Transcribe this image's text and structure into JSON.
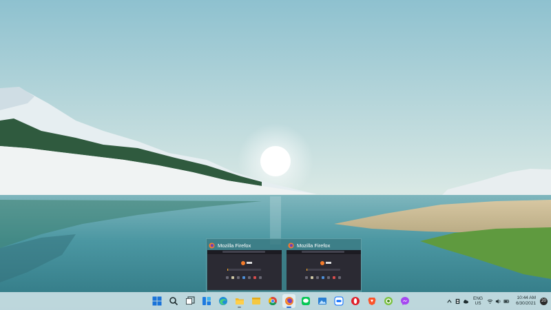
{
  "wallpaper": {
    "sky_top": "#8ec1cf",
    "sky_bottom": "#c7dfde",
    "water": "#4d96a1",
    "sun": "#ffffff"
  },
  "thumbnails": {
    "items": [
      {
        "title": "Mozilla Firefox"
      },
      {
        "title": "Mozilla Firefox"
      }
    ]
  },
  "taskbar": {
    "accent": "#2a6ad4",
    "apps": [
      {
        "name": "start-button",
        "icon": "windows-logo-icon",
        "running": false
      },
      {
        "name": "search-button",
        "icon": "search-icon",
        "running": false
      },
      {
        "name": "task-view-button",
        "icon": "task-view-icon",
        "running": false
      },
      {
        "name": "widgets-button",
        "icon": "widgets-icon",
        "running": false
      },
      {
        "name": "edge-button",
        "icon": "edge-icon",
        "running": false
      },
      {
        "name": "file-explorer-button",
        "icon": "folder-icon",
        "running": true
      },
      {
        "name": "sticky-notes-button",
        "icon": "sticky-notes-icon",
        "running": false
      },
      {
        "name": "chrome-button",
        "icon": "chrome-icon",
        "running": false
      },
      {
        "name": "firefox-button",
        "icon": "firefox-icon",
        "running": true,
        "active": true
      },
      {
        "name": "line-button",
        "icon": "line-icon",
        "running": false
      },
      {
        "name": "photos-button",
        "icon": "photos-icon",
        "running": false
      },
      {
        "name": "zalo-button",
        "icon": "zalo-icon",
        "running": false
      },
      {
        "name": "opera-button",
        "icon": "opera-icon",
        "running": false
      },
      {
        "name": "brave-button",
        "icon": "brave-icon",
        "running": false
      },
      {
        "name": "coccoc-button",
        "icon": "coccoc-icon",
        "running": false
      },
      {
        "name": "messenger-button",
        "icon": "messenger-icon",
        "running": false
      }
    ]
  },
  "tray": {
    "lang_line1": "ENG",
    "lang_line2": "US",
    "time": "10:44 AM",
    "date": "6/30/2021",
    "notification_count": "20"
  }
}
